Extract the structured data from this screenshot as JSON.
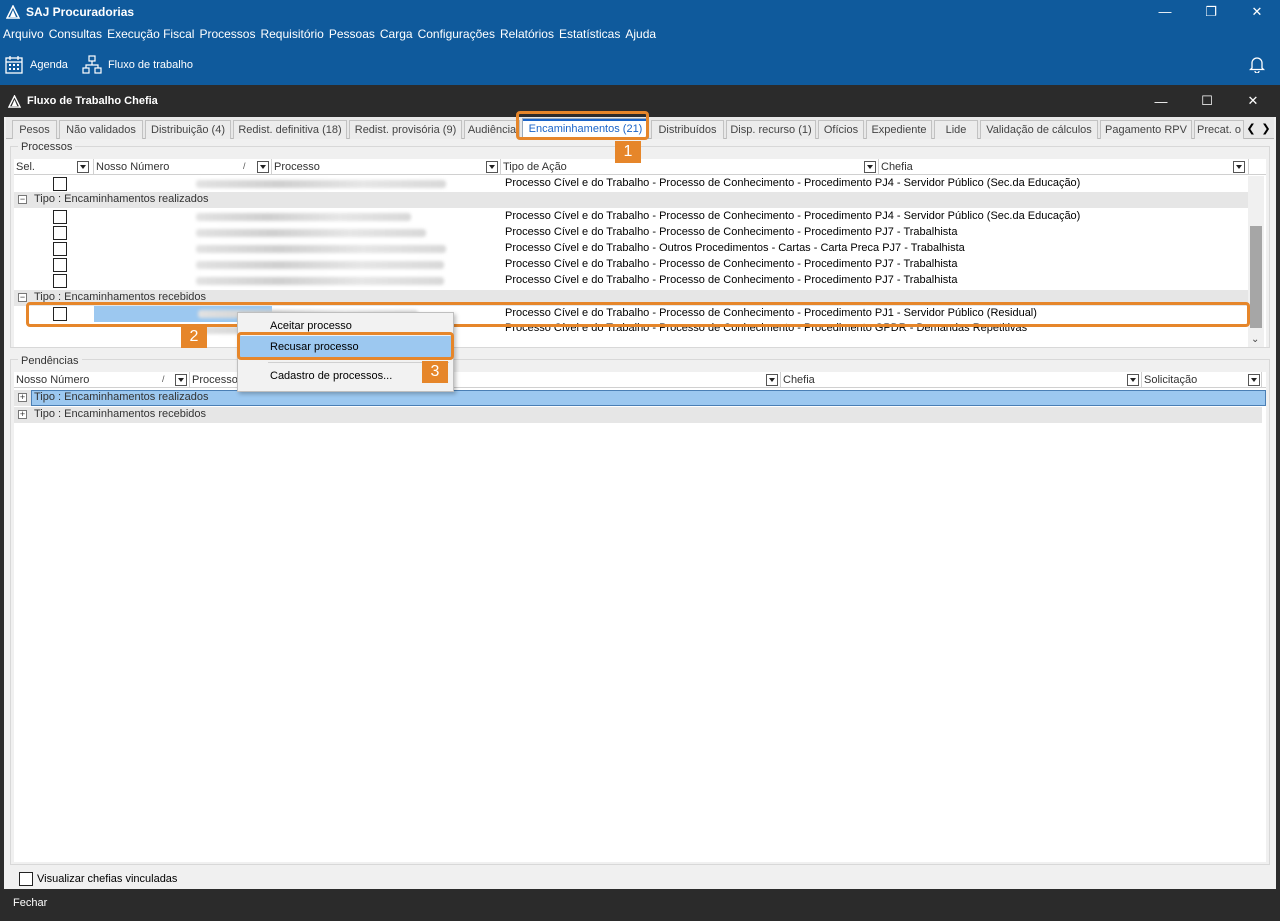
{
  "app": {
    "title": "SAJ Procuradorias",
    "menu": [
      "Arquivo",
      "Consultas",
      "Execução Fiscal",
      "Processos",
      "Requisitório",
      "Pessoas",
      "Carga",
      "Configurações",
      "Relatórios",
      "Estatísticas",
      "Ajuda"
    ],
    "toolbar": {
      "agenda": "Agenda",
      "fluxo": "Fluxo de trabalho"
    },
    "accent": "#0f5a9c"
  },
  "window": {
    "title": "Fluxo de Trabalho Chefia"
  },
  "tabs": [
    "Pesos",
    "Não validados",
    "Distribuição (4)",
    "Redist. definitiva (18)",
    "Redist. provisória (9)",
    "Audiência",
    "Encaminhamentos (21)",
    "Distribuídos",
    "Disp. recurso (1)",
    "Ofícios",
    "Expediente",
    "Lide",
    "Validação de cálculos",
    "Pagamento RPV",
    "Precat. o"
  ],
  "processos": {
    "label": "Processos",
    "columns": [
      "Sel.",
      "Nosso Número",
      "Processo",
      "Tipo de Ação",
      "Chefia"
    ],
    "sort_mark": "/",
    "row0": {
      "tipo": "Processo Cível e do Trabalho - Processo de Conhecimento - Procedimento PJ4 - Servidor Público (Sec.da Educação)"
    },
    "group1": {
      "label": "Tipo : Encaminhamentos realizados",
      "rows": [
        "Processo Cível e do Trabalho - Processo de Conhecimento - Procedimento PJ4 - Servidor Público (Sec.da Educação)",
        "Processo Cível e do Trabalho - Processo de Conhecimento - Procedimento PJ7 - Trabalhista",
        "Processo Cível e do Trabalho - Outros Procedimentos - Cartas - Carta Preca PJ7 - Trabalhista",
        "Processo Cível e do Trabalho - Processo de Conhecimento - Procedimento PJ7 - Trabalhista",
        "Processo Cível e do Trabalho - Processo de Conhecimento - Procedimento PJ7 - Trabalhista"
      ]
    },
    "group2": {
      "label": "Tipo : Encaminhamentos recebidos",
      "rows": [
        "Processo Cível e do Trabalho - Processo de Conhecimento - Procedimento PJ1 - Servidor Público (Residual)",
        "Processo Cível e do Trabalho - Processo de Conhecimento - Procedimento GPDR - Demandas Repetitivas"
      ]
    }
  },
  "pendencias": {
    "label": "Pendências",
    "columns": [
      "Nosso Número",
      "Processo",
      "Chefia",
      "Solicitação"
    ],
    "sort_mark": "/",
    "groups": [
      "Tipo : Encaminhamentos realizados",
      "Tipo : Encaminhamentos recebidos"
    ]
  },
  "context_menu": [
    "Aceitar processo",
    "Recusar processo",
    "Cadastro de processos..."
  ],
  "callouts": [
    "1",
    "2",
    "3"
  ],
  "footer": {
    "checkbox_label": "Visualizar chefias vinculadas",
    "close": "Fechar"
  }
}
